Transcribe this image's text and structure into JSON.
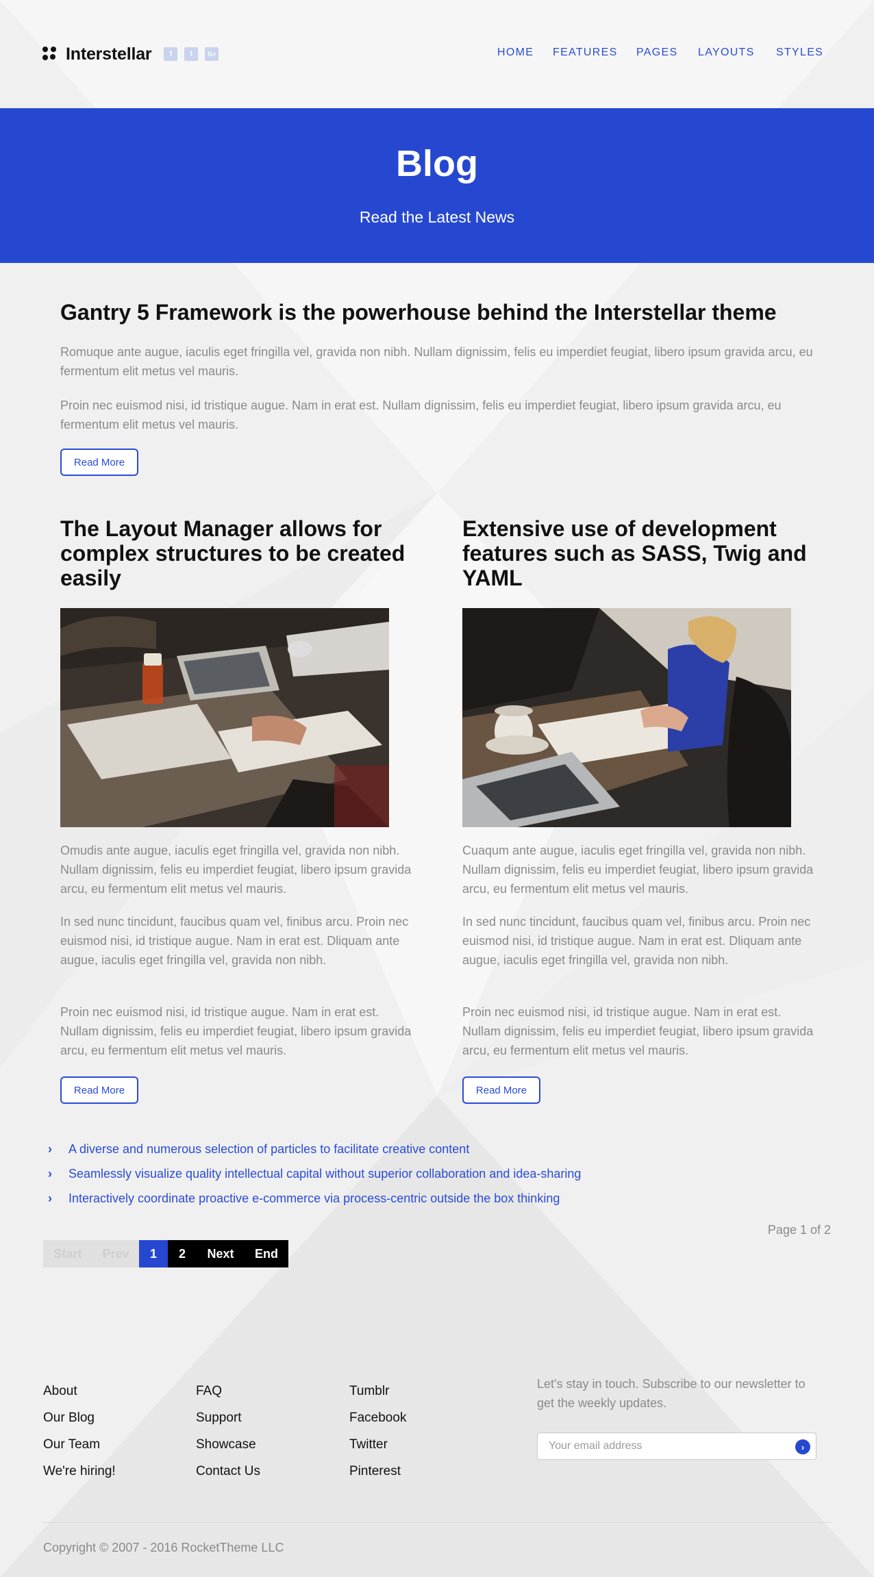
{
  "colors": {
    "accent": "#2648d0",
    "link": "#2a4bd7",
    "body_text": "#8a8a8a",
    "page_bg": "#f0f0f0"
  },
  "header": {
    "brand": "Interstellar",
    "social": [
      {
        "icon": "facebook-icon",
        "glyph": "f"
      },
      {
        "icon": "twitter-icon",
        "glyph": "t"
      },
      {
        "icon": "google-plus-icon",
        "glyph": "G+"
      }
    ],
    "nav": [
      "HOME",
      "FEATURES",
      "PAGES",
      "LAYOUTS",
      "STYLES"
    ]
  },
  "hero": {
    "title": "Blog",
    "subtitle": "Read the Latest News"
  },
  "featured": {
    "title": "Gantry 5 Framework is the powerhouse behind the Interstellar theme",
    "paragraphs": [
      "Romuque ante augue, iaculis eget fringilla vel, gravida non nibh. Nullam dignissim, felis eu imperdiet feugiat, libero ipsum gravida arcu, eu fermentum elit metus vel mauris.",
      "Proin nec euismod nisi, id tristique augue. Nam in erat est. Nullam dignissim, felis eu imperdiet feugiat, libero ipsum gravida arcu, eu fermentum elit metus vel mauris."
    ],
    "button": "Read More"
  },
  "posts": [
    {
      "title": "The Layout Manager allows for complex structures to be created easily",
      "image": "team-meeting-photo",
      "paragraphs": [
        "Omudis ante augue, iaculis eget fringilla vel, gravida non nibh. Nullam dignissim, felis eu imperdiet feugiat, libero ipsum gravida arcu, eu fermentum elit metus vel mauris.",
        "In sed nunc tincidunt, faucibus quam vel, finibus arcu. Proin nec euismod nisi, id tristique augue. Nam in erat est. Dliquam ante augue, iaculis eget fringilla vel, gravida non nibh.",
        "Proin nec euismod nisi, id tristique augue. Nam in erat est. Nullam dignissim, felis eu imperdiet feugiat, libero ipsum gravida arcu, eu fermentum elit metus vel mauris."
      ],
      "button": "Read More"
    },
    {
      "title": "Extensive use of development features such as SASS, Twig and YAML",
      "image": "coffee-laptop-photo",
      "paragraphs": [
        "Cuaqum ante augue, iaculis eget fringilla vel, gravida non nibh. Nullam dignissim, felis eu imperdiet feugiat, libero ipsum gravida arcu, eu fermentum elit metus vel mauris.",
        "In sed nunc tincidunt, faucibus quam vel, finibus arcu. Proin nec euismod nisi, id tristique augue. Nam in erat est. Dliquam ante augue, iaculis eget fringilla vel, gravida non nibh.",
        "Proin nec euismod nisi, id tristique augue. Nam in erat est. Nullam dignissim, felis eu imperdiet feugiat, libero ipsum gravida arcu, eu fermentum elit metus vel mauris."
      ],
      "button": "Read More"
    }
  ],
  "more_links": [
    "A diverse and numerous selection of particles to facilitate creative content",
    "Seamlessly visualize quality intellectual capital without superior collaboration and idea-sharing",
    "Interactively coordinate proactive e-commerce via process-centric outside the box thinking"
  ],
  "pagination": {
    "counter": "Page 1 of 2",
    "start": "Start",
    "prev": "Prev",
    "pages": [
      "1",
      "2"
    ],
    "next": "Next",
    "end": "End"
  },
  "footer": {
    "columns": [
      [
        "About",
        "Our Blog",
        "Our Team",
        "We're hiring!"
      ],
      [
        "FAQ",
        "Support",
        "Showcase",
        "Contact Us"
      ],
      [
        "Tumblr",
        "Facebook",
        "Twitter",
        "Pinterest"
      ]
    ],
    "newsletter_text": "Let's stay in touch. Subscribe to our newsletter to get the weekly updates.",
    "email_placeholder": "Your email address",
    "copyright": "Copyright © 2007 - 2016 RocketTheme LLC"
  }
}
